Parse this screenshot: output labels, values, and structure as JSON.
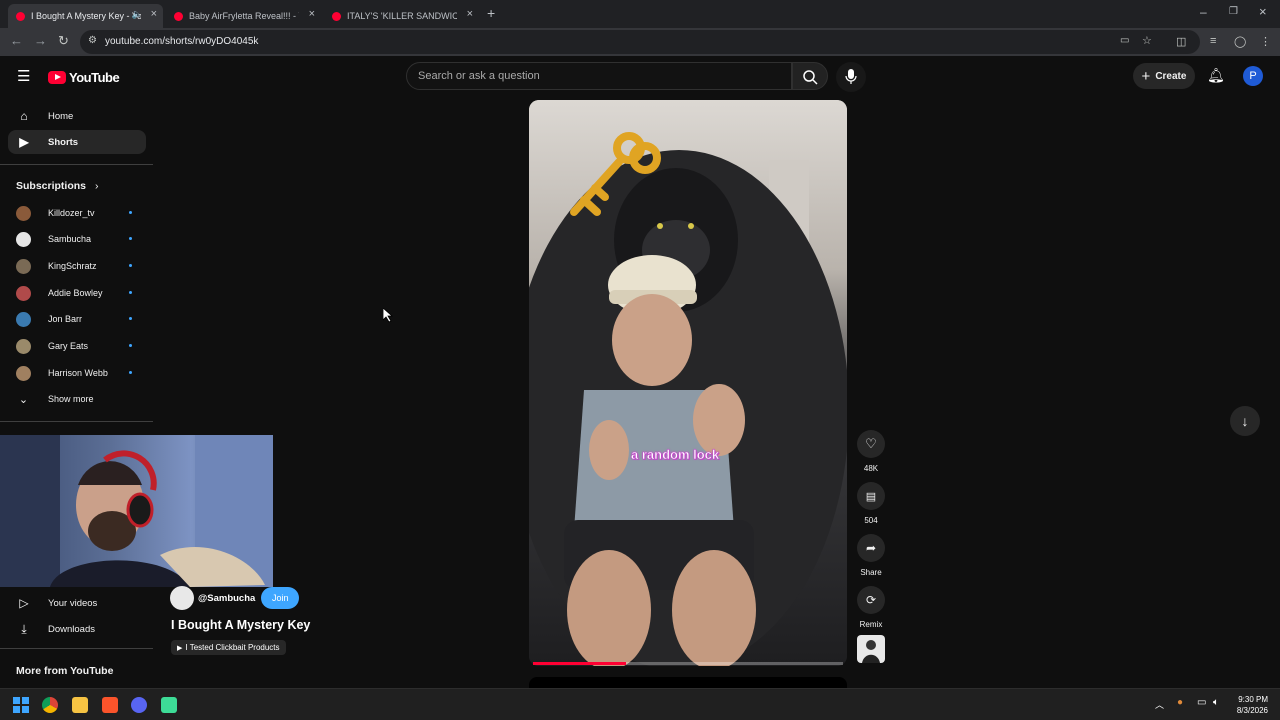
{
  "browser": {
    "tabs": [
      {
        "title": "I Bought A Mystery Key - Yo",
        "active": true
      },
      {
        "title": "Baby AirFryletta Reveal!!! - You",
        "active": false
      },
      {
        "title": "ITALY'S 'KILLER SANDWICH CH",
        "active": false
      }
    ],
    "url": "youtube.com/shorts/rw0yDO4045k"
  },
  "masthead": {
    "logo_text": "YouTube",
    "search_placeholder": "Search or ask a question",
    "create_label": "Create",
    "avatar_letter": "P"
  },
  "sidebar": {
    "items": [
      {
        "label": "Home",
        "icon": "home-icon"
      },
      {
        "label": "Shorts",
        "icon": "shorts-icon",
        "active": true
      }
    ],
    "subscriptions_title": "Subscriptions",
    "subscriptions": [
      {
        "name": "Killdozer_tv",
        "color": "#8a5a3a"
      },
      {
        "name": "Sambucha",
        "color": "#e6e6e6"
      },
      {
        "name": "KingSchratz",
        "color": "#7a6a55"
      },
      {
        "name": "Addie Bowley",
        "color": "#b04a4a"
      },
      {
        "name": "Jon Barr",
        "color": "#3a7ab0"
      },
      {
        "name": "Gary Eats",
        "color": "#9a8a6a"
      },
      {
        "name": "Harrison Webb",
        "color": "#a08060"
      }
    ],
    "show_more": "Show more",
    "you_items": [
      {
        "label": "Your videos",
        "icon": "your-videos-icon"
      },
      {
        "label": "Downloads",
        "icon": "download-icon"
      }
    ],
    "more_title": "More from YouTube"
  },
  "short": {
    "caption": "a random lock",
    "channel": "@Sambucha",
    "join_label": "Join",
    "title": "I Bought A Mystery Key",
    "playlist": "I Tested Clickbait Products",
    "progress_fraction": 0.3,
    "actions": {
      "likes": "48K",
      "comments": "504",
      "share": "Share",
      "remix": "Remix"
    }
  },
  "taskbar": {
    "time": "9:30 PM",
    "date": "8/3/2026"
  }
}
